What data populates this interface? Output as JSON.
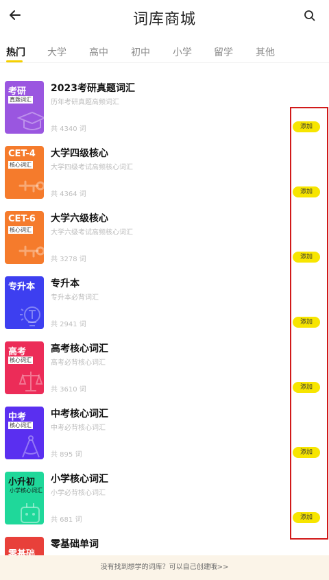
{
  "header": {
    "title": "词库商城",
    "back_icon": "arrow-left-icon",
    "search_icon": "search-icon"
  },
  "tabs": [
    {
      "label": "热门",
      "active": true
    },
    {
      "label": "大学"
    },
    {
      "label": "高中"
    },
    {
      "label": "初中"
    },
    {
      "label": "小学"
    },
    {
      "label": "留学"
    },
    {
      "label": "其他"
    }
  ],
  "books": [
    {
      "cover_code": "考研",
      "cover_sub": "真题词汇",
      "cover_color": "#9a56e0",
      "name": "2023考研真题词汇",
      "desc": "历年考研真题高频词汇",
      "count": "共 4340 词",
      "add_label": "添加"
    },
    {
      "cover_code": "CET-4",
      "cover_sub": "核心词汇",
      "cover_color": "#f57b2c",
      "name": "大学四级核心",
      "desc": "大学四级考试高频核心词汇",
      "count": "共 4364 词",
      "add_label": "添加"
    },
    {
      "cover_code": "CET-6",
      "cover_sub": "核心词汇",
      "cover_color": "#f57b2c",
      "name": "大学六级核心",
      "desc": "大学六级考试高频核心词汇",
      "count": "共 3278 词",
      "add_label": "添加"
    },
    {
      "cover_code": "专升本",
      "cover_sub": "",
      "cover_color": "#3d3ff0",
      "name": "专升本",
      "desc": "专升本必背词汇",
      "count": "共 2941 词",
      "add_label": "添加"
    },
    {
      "cover_code": "高考",
      "cover_sub": "核心词汇",
      "cover_color": "#ec2c58",
      "name": "高考核心词汇",
      "desc": "高考必背核心词汇",
      "count": "共 3610 词",
      "add_label": "添加"
    },
    {
      "cover_code": "中考",
      "cover_sub": "核心词汇",
      "cover_color": "#5a2ff0",
      "name": "中考核心词汇",
      "desc": "中考必背核心词汇",
      "count": "共 895 词",
      "add_label": "添加"
    },
    {
      "cover_code": "小升初",
      "cover_sub": "小学核心词汇",
      "cover_color": "#1fd89a",
      "name": "小学核心词汇",
      "desc": "小学必背核心词汇",
      "count": "共 681 词",
      "add_label": "添加"
    },
    {
      "cover_code": "零基础",
      "cover_sub": "",
      "cover_color": "#e8403a",
      "name": "零基础单词",
      "desc": "",
      "count": "",
      "add_label": ""
    }
  ],
  "footer": {
    "text": "没有找到想学的词库？可以自己创建哦>>"
  },
  "colors": {
    "accent": "#f7e500",
    "highlight": "#d11a1a",
    "footer_bg": "#fbf4e8"
  }
}
